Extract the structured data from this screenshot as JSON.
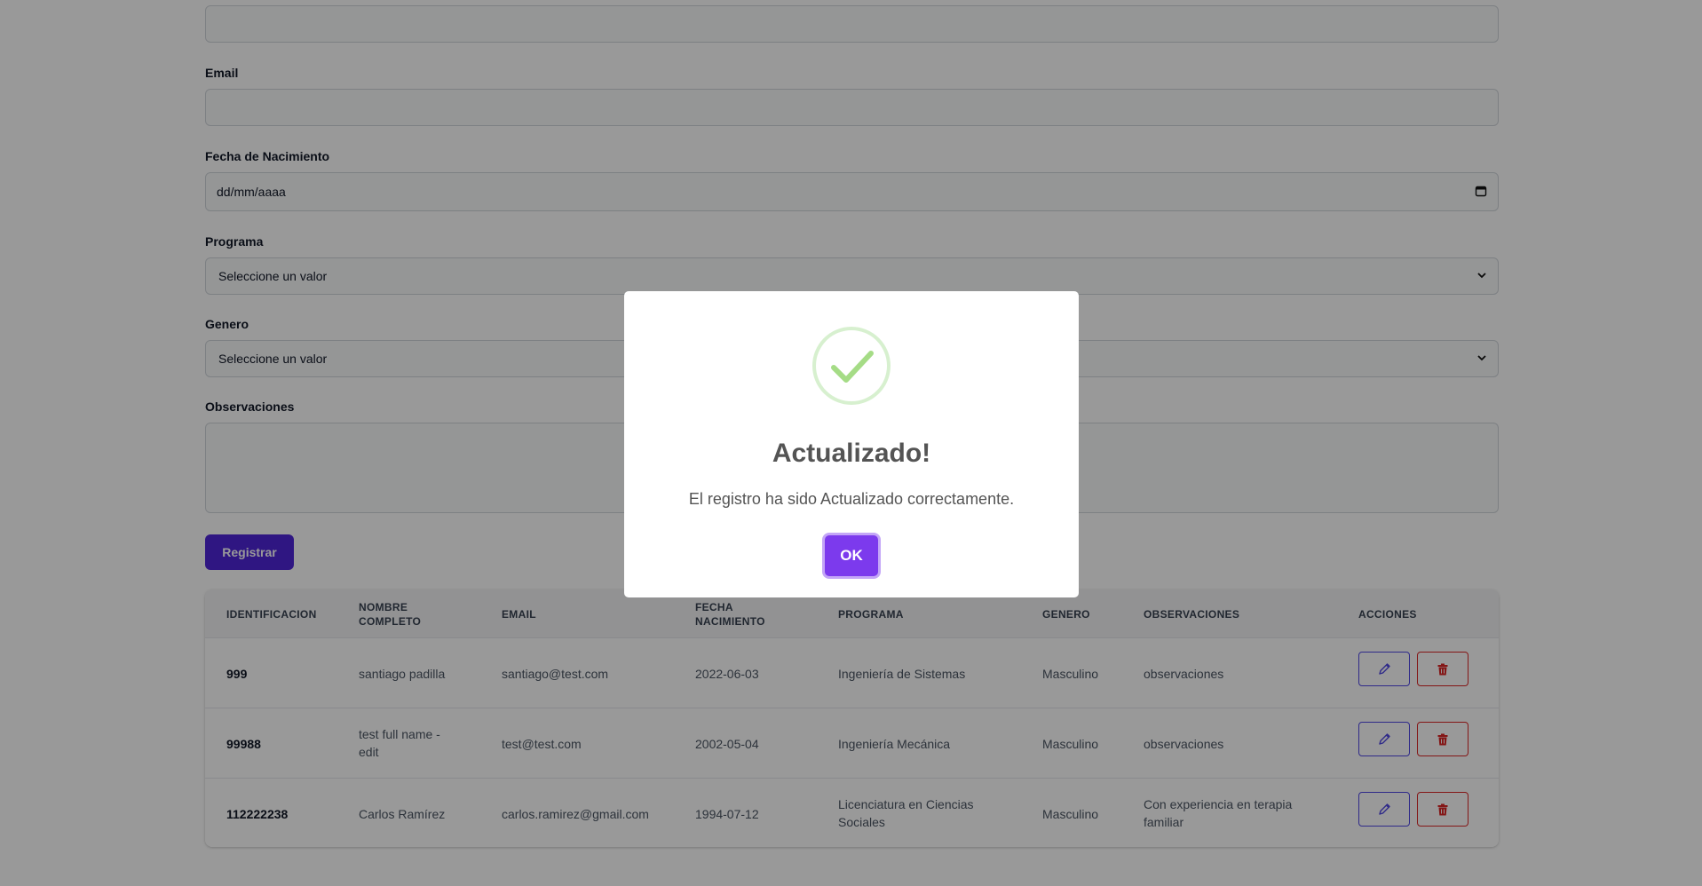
{
  "form": {
    "email_label": "Email",
    "birthdate_label": "Fecha de Nacimiento",
    "birthdate_placeholder": "dd/mm/aaaa",
    "program_label": "Programa",
    "program_selected": "Seleccione un valor",
    "gender_label": "Genero",
    "gender_selected": "Seleccione un valor",
    "observations_label": "Observaciones",
    "submit_label": "Registrar"
  },
  "table": {
    "headers": {
      "id": "IDENTIFICACION",
      "name_1": "NOMBRE",
      "name_2": "COMPLETO",
      "email": "EMAIL",
      "birth_1": "FECHA",
      "birth_2": "NACIMIENTO",
      "program": "PROGRAMA",
      "gender": "GENERO",
      "observations": "OBSERVACIONES",
      "actions": "ACCIONES"
    },
    "rows": [
      {
        "id": "999",
        "name_1": "santiago padilla",
        "name_2": "",
        "email": "santiago@test.com",
        "birth": "2022-06-03",
        "program_1": "Ingeniería de Sistemas",
        "program_2": "",
        "gender": "Masculino",
        "obs_1": "observaciones",
        "obs_2": ""
      },
      {
        "id": "99988",
        "name_1": "test full name -",
        "name_2": "edit",
        "email": "test@test.com",
        "birth": "2002-05-04",
        "program_1": "Ingeniería Mecánica",
        "program_2": "",
        "gender": "Masculino",
        "obs_1": "observaciones",
        "obs_2": ""
      },
      {
        "id": "112222238",
        "name_1": "Carlos Ramírez",
        "name_2": "",
        "email": "carlos.ramirez@gmail.com",
        "birth": "1994-07-12",
        "program_1": "Licenciatura en Ciencias",
        "program_2": "Sociales",
        "gender": "Masculino",
        "obs_1": "Con experiencia en terapia",
        "obs_2": "familiar"
      }
    ]
  },
  "modal": {
    "icon": "success-check-icon",
    "title": "Actualizado!",
    "message": "El registro ha sido Actualizado correctamente.",
    "ok_label": "OK"
  },
  "colors": {
    "primary": "#4f25d9",
    "modal_button": "#7c3aed",
    "edit_accent": "#4f46e5",
    "delete_accent": "#dc2626",
    "success": "#a5dc86"
  }
}
